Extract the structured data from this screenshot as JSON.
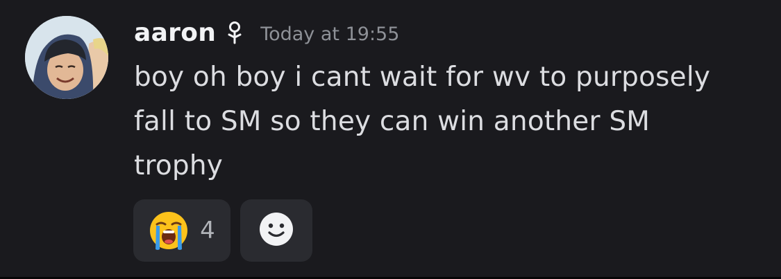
{
  "message": {
    "author": "aaron",
    "timestamp": "Today at 19:55",
    "content": "boy oh boy i cant wait for wv to purposely fall to SM so they can win another SM trophy"
  },
  "icons": {
    "role": "sprout-icon",
    "avatar": "user-avatar-photo",
    "reaction": "loudly-crying-face-emoji",
    "add_reaction": "smiley-face-icon"
  },
  "reactions": [
    {
      "emoji": "loudly-crying-face",
      "count": "4"
    }
  ],
  "colors": {
    "background": "#1a1a1e",
    "username": "#f2f3f5",
    "timestamp": "#8e9197",
    "content": "#dcdde1",
    "reaction_bg": "#2a2b30"
  }
}
